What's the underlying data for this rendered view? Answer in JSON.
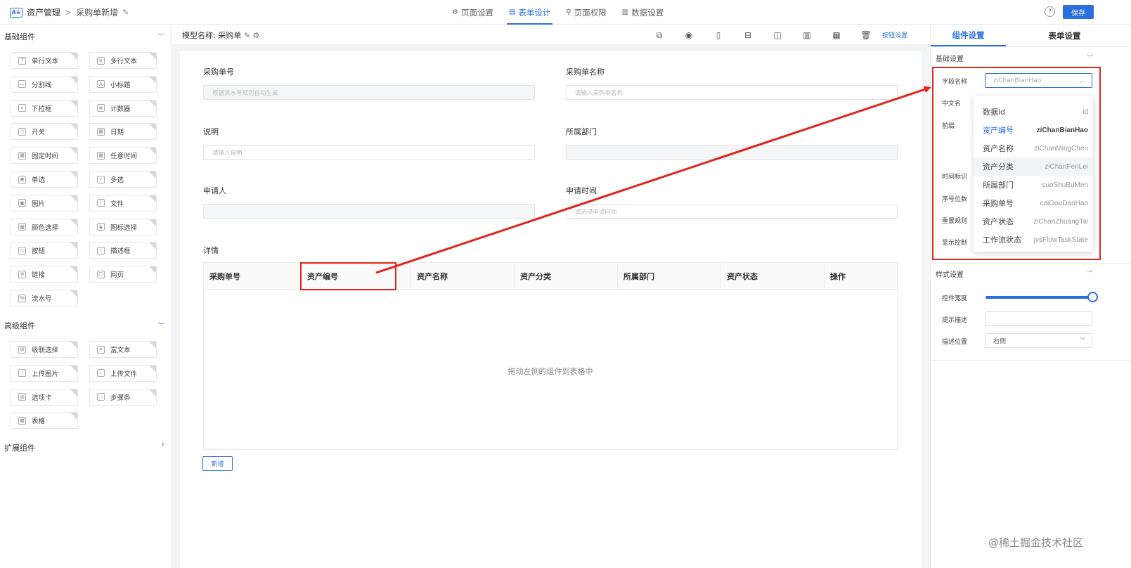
{
  "topbar": {
    "logo": "A≡",
    "app_name": "资产管理",
    "separator": ">",
    "page_name": "采购单新增",
    "edit_glyph": "✎",
    "tabs": [
      {
        "icon": "⚙",
        "label": "页面设置"
      },
      {
        "icon": "▤",
        "label": "表单设计"
      },
      {
        "icon": "⚲",
        "label": "页面权限"
      },
      {
        "icon": "▥",
        "label": "数据设置"
      }
    ],
    "active_tab": 1,
    "help_glyph": "?",
    "save_label": "保存"
  },
  "left": {
    "basic_title": "基础组件",
    "advanced_title": "高级组件",
    "extension_title": "扩展组件",
    "chev_down": "﹀",
    "chev_right": "›",
    "basic": [
      {
        "label": "单行文本",
        "icon": "T"
      },
      {
        "label": "多行文本",
        "icon": "≡"
      },
      {
        "label": "分割线",
        "icon": "—"
      },
      {
        "label": "小标题",
        "icon": "A"
      },
      {
        "label": "下拉框",
        "icon": "▾"
      },
      {
        "label": "计数器",
        "icon": "#"
      },
      {
        "label": "开关",
        "icon": "○"
      },
      {
        "label": "日期",
        "icon": "▦"
      },
      {
        "label": "固定时间",
        "icon": "▦"
      },
      {
        "label": "任意时间",
        "icon": "▦"
      },
      {
        "label": "单选",
        "icon": "◉"
      },
      {
        "label": "多选",
        "icon": "✓"
      },
      {
        "label": "图片",
        "icon": "▣"
      },
      {
        "label": "文件",
        "icon": "⌇"
      },
      {
        "label": "颜色选择",
        "icon": "▩"
      },
      {
        "label": "图标选择",
        "icon": "♟"
      },
      {
        "label": "按钮",
        "icon": "▭"
      },
      {
        "label": "描述框",
        "icon": "i"
      },
      {
        "label": "链接",
        "icon": "⊕"
      },
      {
        "label": "网页",
        "icon": "▢"
      },
      {
        "label": "流水号",
        "icon": "№"
      }
    ],
    "advanced": [
      {
        "label": "级联选择",
        "icon": "⊞"
      },
      {
        "label": "富文本",
        "icon": "⌗"
      },
      {
        "label": "上传图片",
        "icon": "⌇"
      },
      {
        "label": "上传文件",
        "icon": "⌇"
      },
      {
        "label": "选项卡",
        "icon": "▤"
      },
      {
        "label": "步骤条",
        "icon": "⋯"
      },
      {
        "label": "表格",
        "icon": "▦"
      }
    ]
  },
  "center": {
    "model_label": "模型名称:",
    "model_name": "采购单",
    "tools": [
      "⧉",
      "◉",
      "▯",
      "⊟",
      "◫",
      "▥",
      "▦",
      "🗑"
    ],
    "tool_link": "按钮设置",
    "fields": [
      {
        "label": "采购单号",
        "placeholder": "根据流水号规则自动生成"
      },
      {
        "label": "采购单名称",
        "placeholder": "请输入采购单名称"
      },
      {
        "label": "说明",
        "placeholder": "请输入说明"
      },
      {
        "label": "所属部门",
        "placeholder": ""
      },
      {
        "label": "申请人",
        "placeholder": ""
      },
      {
        "label": "申请时间",
        "placeholder": "请选择申请时间"
      }
    ],
    "detail_label": "详情",
    "table_headers": [
      "采购单号",
      "资产编号",
      "资产名称",
      "资产分类",
      "所属部门",
      "资产状态",
      "操作"
    ],
    "empty_hint": "拖动左侧的组件到表格中",
    "add_label": "新增"
  },
  "right": {
    "tabs": [
      "组件设置",
      "表单设置"
    ],
    "basic_section": "基础设置",
    "style_section": "样式设置",
    "chev_down": "﹀",
    "field_name_label": "字段名称",
    "field_name_value": "ziChanBianHao",
    "labels": [
      "中文名",
      "前缀",
      "时间标识",
      "序号位数",
      "重置规则",
      "显示控制"
    ],
    "dropdown": [
      {
        "name": "数据id",
        "value": "id"
      },
      {
        "name": "资产编号",
        "value": "ziChanBianHao"
      },
      {
        "name": "资产名称",
        "value": "ziChanMingChen"
      },
      {
        "name": "资产分类",
        "value": "ziChanFenLei"
      },
      {
        "name": "所属部门",
        "value": "suoShuBuMen"
      },
      {
        "name": "采购单号",
        "value": "caiGouDanHao"
      },
      {
        "name": "资产状态",
        "value": "ziChanZhuangTai"
      },
      {
        "name": "工作流状态",
        "value": "jvsFlowTaskState"
      }
    ],
    "selected_index": 1,
    "hover_index": 3,
    "width_label": "控件宽度",
    "width_value": 1.0,
    "hint_label": "提示描述",
    "hint_value": "",
    "desc_pos_label": "描述位置",
    "desc_pos_value": "右侧"
  },
  "watermark": "@稀土掘金技术社区",
  "colors": {
    "accent": "#2a6fe0",
    "annotation": "#e0261c"
  }
}
